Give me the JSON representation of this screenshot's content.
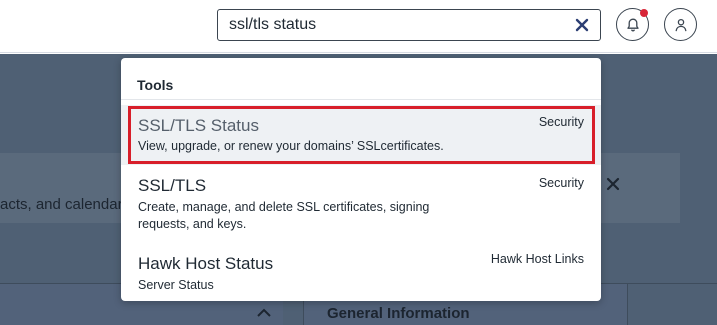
{
  "search": {
    "value": "ssl/tls status",
    "clear_icon": "close-icon"
  },
  "header_icons": {
    "notifications": "bell-icon",
    "account": "user-icon",
    "notif_dot_color": "#d72638"
  },
  "background": {
    "partial_text": "acts, and calendars",
    "panel_title": "General Information"
  },
  "dropdown": {
    "section_title": "Tools",
    "results": [
      {
        "title": "SSL/TLS Status",
        "description": "View, upgrade, or renew your domains’ SSLcertificates.",
        "category": "Security"
      },
      {
        "title": "SSL/TLS",
        "description": "Create, manage, and delete SSL certificates, signing requests, and keys.",
        "category": "Security"
      },
      {
        "title": "Hawk Host Status",
        "description": "Server Status",
        "category": "Hawk Host Links"
      }
    ]
  },
  "colors": {
    "highlight_border": "#d81e2a",
    "overlay": "#4f6074"
  }
}
